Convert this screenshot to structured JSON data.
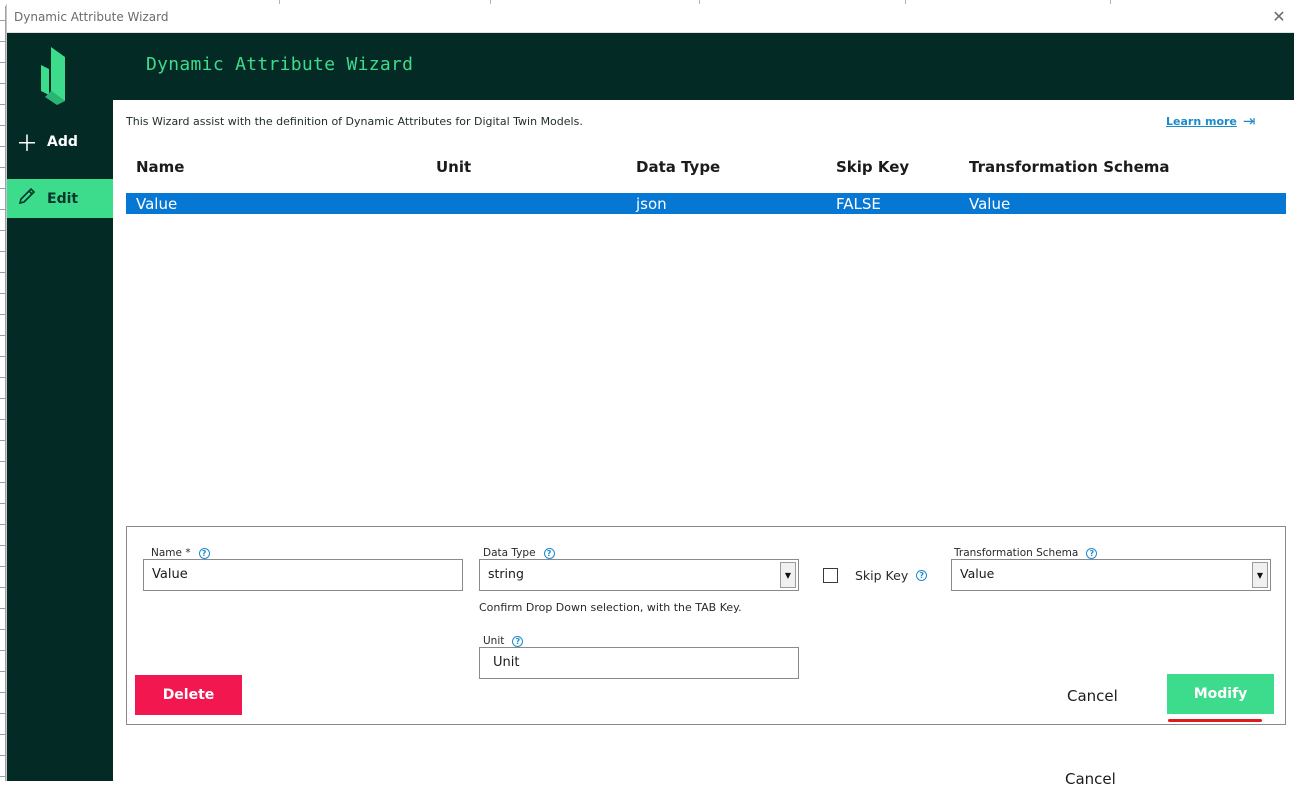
{
  "window": {
    "title": "Dynamic Attribute Wizard"
  },
  "sidebar": {
    "items": [
      {
        "label": "Add",
        "icon": "plus-icon"
      },
      {
        "label": "Edit",
        "icon": "pencil-icon",
        "active": true
      }
    ]
  },
  "header": {
    "title": "Dynamic Attribute Wizard"
  },
  "intro": {
    "text": "This Wizard assist with the definition of Dynamic Attributes for Digital Twin Models.",
    "learn_more": "Learn more"
  },
  "table": {
    "columns": [
      "Name",
      "Unit",
      "Data Type",
      "Skip Key",
      "Transformation Schema"
    ],
    "rows": [
      {
        "name": "Value",
        "unit": "",
        "data_type": "json",
        "skip_key": "FALSE",
        "schema": "Value"
      }
    ]
  },
  "form": {
    "name_label": "Name *",
    "name_value": "Value",
    "data_type_label": "Data Type",
    "data_type_value": "string",
    "data_type_hint": "Confirm Drop Down selection, with the TAB Key.",
    "skip_key_label": "Skip Key",
    "skip_key_checked": false,
    "schema_label": "Transformation Schema",
    "schema_value": "Value",
    "unit_label": "Unit",
    "unit_value": "Unit",
    "delete_label": "Delete",
    "cancel_label": "Cancel",
    "modify_label": "Modify"
  },
  "footer": {
    "cancel_label": "Cancel"
  },
  "colors": {
    "sidebar_bg": "#032a24",
    "accent_green": "#3ddb8c",
    "selection_blue": "#0678d4",
    "delete_red": "#f2184f",
    "link_blue": "#1a8ccc"
  }
}
